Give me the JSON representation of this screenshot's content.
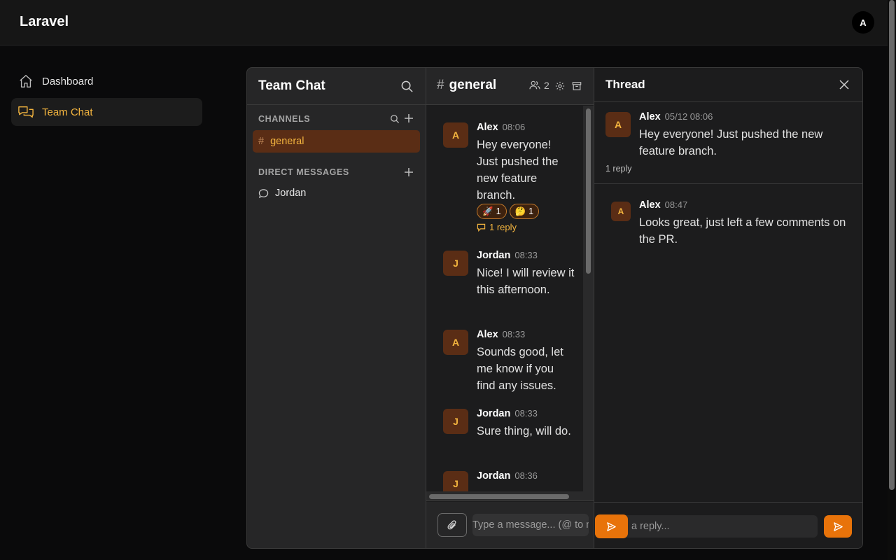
{
  "app": {
    "brand": "Laravel",
    "user_initial": "A"
  },
  "nav": {
    "items": [
      {
        "label": "Dashboard",
        "icon": "home-icon"
      },
      {
        "label": "Team Chat",
        "icon": "chat-bubbles-icon",
        "active": true
      }
    ]
  },
  "sidebar": {
    "title": "Team Chat",
    "channels_label": "CHANNELS",
    "channels": [
      {
        "name": "general",
        "active": true
      }
    ],
    "dm_label": "DIRECT MESSAGES",
    "dms": [
      {
        "name": "Jordan"
      }
    ]
  },
  "channel": {
    "hash": "#",
    "name": "general",
    "member_count": "2",
    "messages": [
      {
        "initial": "A",
        "author": "Alex",
        "time": "08:06",
        "text": "Hey everyone! Just pushed the new feature branch.",
        "reactions": [
          {
            "emoji": "🚀",
            "count": "1"
          },
          {
            "emoji": "🤔",
            "count": "1"
          }
        ],
        "reply_label": "1 reply"
      },
      {
        "initial": "J",
        "author": "Jordan",
        "time": "08:33",
        "text": "Nice! I will review it this afternoon."
      },
      {
        "initial": "A",
        "author": "Alex",
        "time": "08:33",
        "text": "Sounds good, let me know if you find any issues."
      },
      {
        "initial": "J",
        "author": "Jordan",
        "time": "08:33",
        "text": "Sure thing, will do."
      },
      {
        "initial": "J",
        "author": "Jordan",
        "time": "08:36",
        "text": ""
      }
    ],
    "composer_placeholder": "Type a message... (@ to mention)"
  },
  "thread": {
    "title": "Thread",
    "parent": {
      "initial": "A",
      "author": "Alex",
      "time": "05/12 08:06",
      "text": "Hey everyone! Just pushed the new feature branch.",
      "reply_count": "1 reply"
    },
    "replies": [
      {
        "initial": "A",
        "author": "Alex",
        "time": "08:47",
        "text": "Looks great, just left a few comments on the PR."
      }
    ],
    "composer_placeholder": "a reply..."
  },
  "colors": {
    "accent": "#f4b53f",
    "button": "#e8730a",
    "avatar_bg": "#5a2d15"
  }
}
